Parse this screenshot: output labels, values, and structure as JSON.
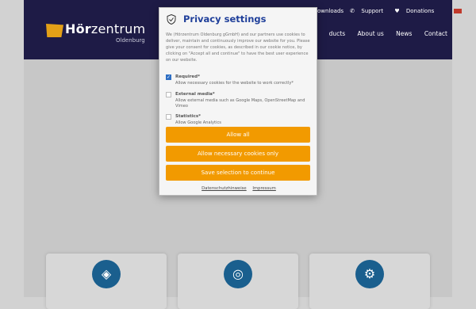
{
  "site": {
    "logo_bold": "Hör",
    "logo_rest": "zentrum",
    "logo_sub": "Oldenburg",
    "top_nav": [
      {
        "label": "ownloads",
        "icon": ""
      },
      {
        "label": "Support",
        "icon": "phone-icon"
      },
      {
        "label": "Donations",
        "icon": "heart-icon"
      }
    ],
    "main_nav": [
      "ducts",
      "About us",
      "News",
      "Contact"
    ]
  },
  "modal": {
    "title": "Privacy settings",
    "intro": "We (Hörzentrum Oldenburg gGmbH) and our partners use cookies to deliver, maintain and continuously improve our website for you. Please give your consent for cookies, as described in our cookie notice, by clicking on \"Accept all and continue\" to have the best user experience on our website.",
    "options": [
      {
        "title": "Required*",
        "desc": "Allow necessary cookies for the website to work correctly*",
        "checked": true
      },
      {
        "title": "External media*",
        "desc": "Allow external media such as Google Maps, OpenStreetMap and Vimeo",
        "checked": false
      },
      {
        "title": "Statistics*",
        "desc": "Allow Google Analytics",
        "checked": false
      }
    ],
    "buttons": {
      "allow_all": "Allow all",
      "allow_necessary": "Allow necessary cookies only",
      "save": "Save selection to continue"
    },
    "links": {
      "privacy": "Datenschutzhinweise",
      "imprint": "Impressum"
    }
  },
  "colors": {
    "header_bg": "#1e1b46",
    "accent": "#f29a00",
    "title_blue": "#1f3f9a",
    "icon_blue": "#1a5f8e"
  }
}
